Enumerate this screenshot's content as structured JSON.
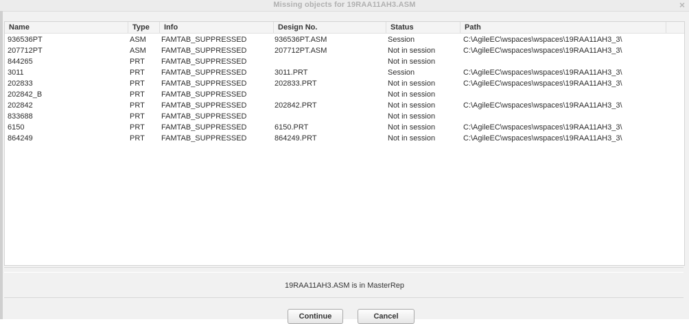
{
  "window": {
    "title": "Missing objects for 19RAA11AH3.ASM",
    "close_glyph": "×"
  },
  "table": {
    "columns": [
      "Name",
      "Type",
      "Info",
      "Design No.",
      "Status",
      "Path"
    ],
    "rows": [
      {
        "name": "936536PT",
        "type": "ASM",
        "info": "FAMTAB_SUPPRESSED",
        "design": "936536PT.ASM",
        "status": "Session",
        "path": "C:\\AgileEC\\wspaces\\wspaces\\19RAA11AH3_3\\"
      },
      {
        "name": "207712PT",
        "type": "ASM",
        "info": "FAMTAB_SUPPRESSED",
        "design": "207712PT.ASM",
        "status": "Not in session",
        "path": "C:\\AgileEC\\wspaces\\wspaces\\19RAA11AH3_3\\"
      },
      {
        "name": "844265",
        "type": "PRT",
        "info": "FAMTAB_SUPPRESSED",
        "design": "",
        "status": "Not in session",
        "path": ""
      },
      {
        "name": "3011",
        "type": "PRT",
        "info": "FAMTAB_SUPPRESSED",
        "design": "3011.PRT",
        "status": "Session",
        "path": "C:\\AgileEC\\wspaces\\wspaces\\19RAA11AH3_3\\"
      },
      {
        "name": "202833",
        "type": "PRT",
        "info": "FAMTAB_SUPPRESSED",
        "design": "202833.PRT",
        "status": "Not in session",
        "path": "C:\\AgileEC\\wspaces\\wspaces\\19RAA11AH3_3\\"
      },
      {
        "name": "202842_B",
        "type": "PRT",
        "info": "FAMTAB_SUPPRESSED",
        "design": "",
        "status": "Not in session",
        "path": ""
      },
      {
        "name": "202842",
        "type": "PRT",
        "info": "FAMTAB_SUPPRESSED",
        "design": "202842.PRT",
        "status": "Not in session",
        "path": "C:\\AgileEC\\wspaces\\wspaces\\19RAA11AH3_3\\"
      },
      {
        "name": "833688",
        "type": "PRT",
        "info": "FAMTAB_SUPPRESSED",
        "design": "",
        "status": "Not in session",
        "path": ""
      },
      {
        "name": "6150",
        "type": "PRT",
        "info": "FAMTAB_SUPPRESSED",
        "design": "6150.PRT",
        "status": "Not in session",
        "path": "C:\\AgileEC\\wspaces\\wspaces\\19RAA11AH3_3\\"
      },
      {
        "name": "864249",
        "type": "PRT",
        "info": "FAMTAB_SUPPRESSED",
        "design": "864249.PRT",
        "status": "Not in session",
        "path": "C:\\AgileEC\\wspaces\\wspaces\\19RAA11AH3_3\\"
      }
    ]
  },
  "footer": {
    "message": "19RAA11AH3.ASM is in MasterRep",
    "continue_label": "Continue",
    "cancel_label": "Cancel"
  }
}
